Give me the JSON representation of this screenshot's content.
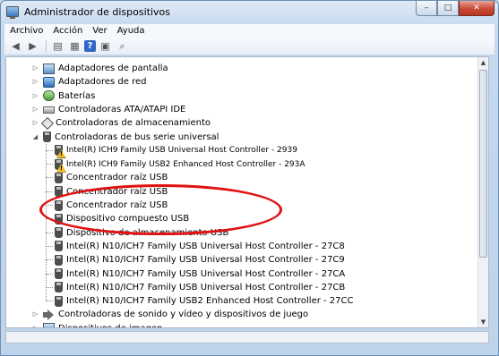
{
  "window": {
    "title": "Administrador de dispositivos",
    "controls": {
      "minimize": "–",
      "maximize": "□",
      "close": "✕"
    }
  },
  "menubar": {
    "items": [
      "Archivo",
      "Acción",
      "Ver",
      "Ayuda"
    ]
  },
  "toolbar": {
    "buttons": [
      "back-arrow-icon",
      "forward-arrow-icon",
      "properties-icon",
      "show-hide-tree-icon",
      "help-icon",
      "scan-hardware-icon"
    ],
    "help_glyph": "?"
  },
  "tree": {
    "categories": [
      {
        "label": "Adaptadores de pantalla",
        "icon": "monitor-icon",
        "expanded": false
      },
      {
        "label": "Adaptadores de red",
        "icon": "network-adapter-icon",
        "expanded": false
      },
      {
        "label": "Baterías",
        "icon": "battery-icon",
        "expanded": false
      },
      {
        "label": "Controladoras ATA/ATAPI IDE",
        "icon": "ata-controller-icon",
        "expanded": false
      },
      {
        "label": "Controladoras de almacenamiento",
        "icon": "storage-controller-icon",
        "expanded": false
      },
      {
        "label": "Controladoras de bus serie universal",
        "icon": "usb-icon",
        "expanded": true
      },
      {
        "label": "Controladoras de sonido y vídeo y dispositivos de juego",
        "icon": "sound-icon",
        "expanded": false
      },
      {
        "label": "Dispositivos de imagen",
        "icon": "camera-icon",
        "expanded": false
      }
    ],
    "usb_children": [
      {
        "label": "Intel(R) ICH9 Family USB Universal Host Controller - 2939",
        "warning": true
      },
      {
        "label": "Intel(R) ICH9 Family USB2 Enhanced Host Controller - 293A",
        "warning": true
      },
      {
        "label": "Concentrador raíz USB",
        "warning": false
      },
      {
        "label": "Concentrador raíz USB",
        "warning": false
      },
      {
        "label": "Concentrador raíz USB",
        "warning": false
      },
      {
        "label": "Dispositivo compuesto USB",
        "warning": false
      },
      {
        "label": "Dispositivo de almacenamiento USB",
        "warning": false
      },
      {
        "label": "Intel(R) N10/ICH7 Family USB Universal Host Controller - 27C8",
        "warning": false
      },
      {
        "label": "Intel(R) N10/ICH7 Family USB Universal Host Controller - 27C9",
        "warning": false
      },
      {
        "label": "Intel(R) N10/ICH7 Family USB Universal Host Controller - 27CA",
        "warning": false
      },
      {
        "label": "Intel(R) N10/ICH7 Family USB Universal Host Controller - 27CB",
        "warning": false
      },
      {
        "label": "Intel(R) N10/ICH7 Family USB2 Enhanced Host Controller - 27CC",
        "warning": false
      }
    ]
  },
  "colors": {
    "annotation": "#e01212",
    "warning": "#f6c02d",
    "frame": "#c6d9ee"
  }
}
